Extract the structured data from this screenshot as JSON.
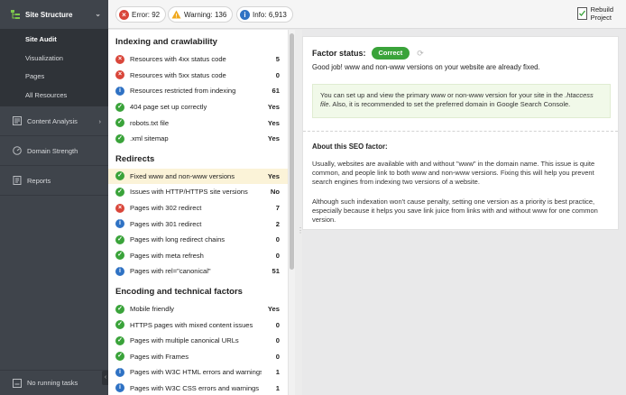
{
  "sidebar": {
    "header": "Site Structure",
    "sub_items": [
      "Site Audit",
      "Visualization",
      "Pages",
      "All Resources"
    ],
    "sections": [
      "Content Analysis",
      "Domain Strength",
      "Reports"
    ],
    "footer": "No running tasks"
  },
  "topbar": {
    "error_label": "Error:",
    "error_count": "92",
    "warning_label": "Warning:",
    "warning_count": "136",
    "info_label": "Info:",
    "info_count": "6,913",
    "rebuild_line1": "Rebuild",
    "rebuild_line2": "Project"
  },
  "groups": [
    {
      "title": "Indexing and crawlability",
      "rows": [
        {
          "status": "error",
          "label": "Resources with 4xx status code",
          "value": "5"
        },
        {
          "status": "error",
          "label": "Resources with 5xx status code",
          "value": "0"
        },
        {
          "status": "info",
          "label": "Resources restricted from indexing",
          "value": "61"
        },
        {
          "status": "ok",
          "label": "404 page set up correctly",
          "value": "Yes"
        },
        {
          "status": "ok",
          "label": "robots.txt file",
          "value": "Yes"
        },
        {
          "status": "ok",
          "label": ".xml sitemap",
          "value": "Yes"
        }
      ]
    },
    {
      "title": "Redirects",
      "rows": [
        {
          "status": "ok",
          "label": "Fixed www and non-www versions",
          "value": "Yes"
        },
        {
          "status": "ok",
          "label": "Issues with HTTP/HTTPS site versions",
          "value": "No"
        },
        {
          "status": "error",
          "label": "Pages with 302 redirect",
          "value": "7"
        },
        {
          "status": "info",
          "label": "Pages with 301 redirect",
          "value": "2"
        },
        {
          "status": "ok",
          "label": "Pages with long redirect chains",
          "value": "0"
        },
        {
          "status": "ok",
          "label": "Pages with meta refresh",
          "value": "0"
        },
        {
          "status": "info",
          "label": "Pages with rel=\"canonical\"",
          "value": "51"
        }
      ]
    },
    {
      "title": "Encoding and technical factors",
      "rows": [
        {
          "status": "ok",
          "label": "Mobile friendly",
          "value": "Yes"
        },
        {
          "status": "ok",
          "label": "HTTPS pages with mixed content issues",
          "value": "0"
        },
        {
          "status": "ok",
          "label": "Pages with multiple canonical URLs",
          "value": "0"
        },
        {
          "status": "ok",
          "label": "Pages with Frames",
          "value": "0"
        },
        {
          "status": "info",
          "label": "Pages with W3C HTML errors and warnings",
          "value": "1"
        },
        {
          "status": "info",
          "label": "Pages with W3C CSS errors and warnings",
          "value": "1"
        }
      ]
    }
  ],
  "detail": {
    "status_label": "Factor status:",
    "status_badge": "Correct",
    "message": "Good job! www and non-www versions on your website are already fixed.",
    "tip_before": "You can set up and view the primary www or non-www version for your site in the ",
    "tip_file": ".htaccess file",
    "tip_after": ". Also, it is recommended to set the preferred domain in Google Search Console.",
    "about_title": "About this SEO factor:",
    "about_p1": "Usually, websites are available with and without \"www\" in the domain name. This issue is quite common, and people link to both www and non-www versions. Fixing this will help you prevent search engines from indexing two versions of a website.",
    "about_p2": "Although such indexation won't cause penalty, setting one version as a priority is best practice, especially because it helps you save link juice from links with and without www for one common version."
  },
  "colors": {
    "ok": "#3aa33a",
    "error": "#d9463a",
    "info": "#2f72c4",
    "warning": "#f0a81c",
    "sidebar": "#3f444b"
  }
}
